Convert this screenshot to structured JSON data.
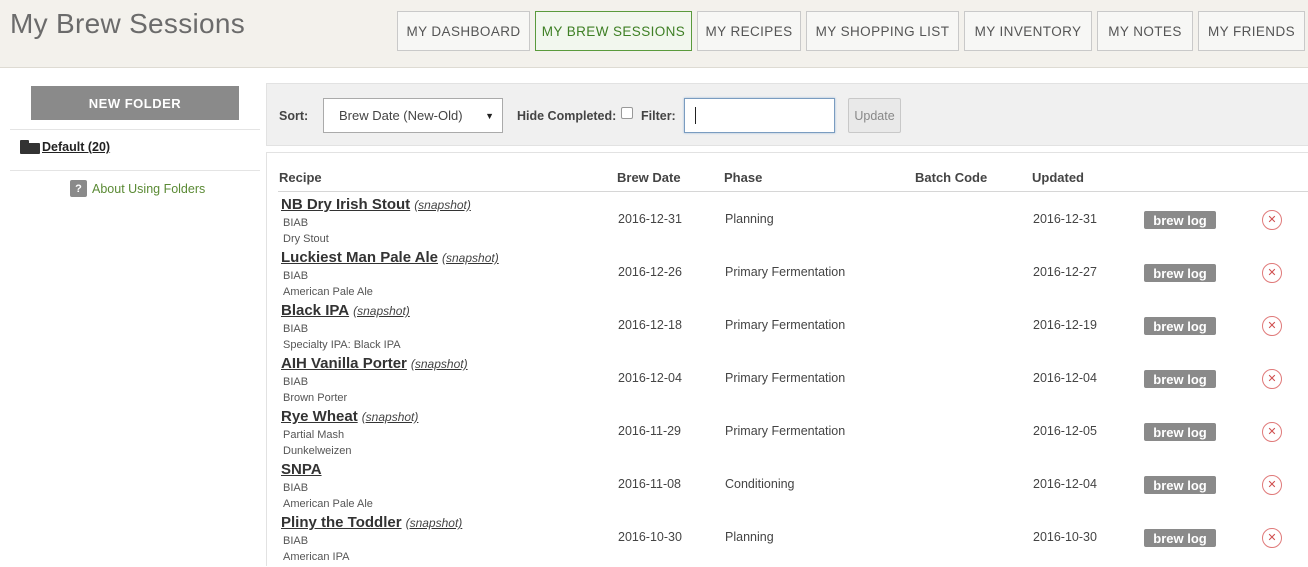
{
  "page": {
    "title": "My Brew Sessions"
  },
  "nav": {
    "tabs": [
      {
        "label": "MY DASHBOARD",
        "active": false
      },
      {
        "label": "MY BREW SESSIONS",
        "active": true
      },
      {
        "label": "MY RECIPES",
        "active": false
      },
      {
        "label": "MY SHOPPING LIST",
        "active": false
      },
      {
        "label": "MY INVENTORY",
        "active": false
      },
      {
        "label": "MY NOTES",
        "active": false
      },
      {
        "label": "MY FRIENDS",
        "active": false
      }
    ]
  },
  "sidebar": {
    "new_folder_label": "NEW FOLDER",
    "folder_label": "Default (20)",
    "help_icon": "?",
    "about_label": "About Using Folders"
  },
  "toolbar": {
    "sort_label": "Sort:",
    "sort_value": "Brew Date (New-Old)",
    "hide_completed_label": "Hide Completed:",
    "filter_label": "Filter:",
    "filter_value": "",
    "update_label": "Update"
  },
  "table": {
    "headers": {
      "recipe": "Recipe",
      "brew_date": "Brew Date",
      "phase": "Phase",
      "batch_code": "Batch Code",
      "updated": "Updated"
    },
    "rows": [
      {
        "name": "NB Dry Irish Stout",
        "snapshot": "(snapshot)",
        "method": "BIAB",
        "style": "Dry Stout",
        "brew_date": "2016-12-31",
        "phase": "Planning",
        "batch_code": "",
        "updated": "2016-12-31",
        "action": "brew log"
      },
      {
        "name": "Luckiest Man Pale Ale",
        "snapshot": "(snapshot)",
        "method": "BIAB",
        "style": "American Pale Ale",
        "brew_date": "2016-12-26",
        "phase": "Primary Fermentation",
        "batch_code": "",
        "updated": "2016-12-27",
        "action": "brew log"
      },
      {
        "name": "Black IPA",
        "snapshot": "(snapshot)",
        "method": "BIAB",
        "style": "Specialty IPA: Black IPA",
        "brew_date": "2016-12-18",
        "phase": "Primary Fermentation",
        "batch_code": "",
        "updated": "2016-12-19",
        "action": "brew log"
      },
      {
        "name": "AIH Vanilla Porter",
        "snapshot": "(snapshot)",
        "method": "BIAB",
        "style": "Brown Porter",
        "brew_date": "2016-12-04",
        "phase": "Primary Fermentation",
        "batch_code": "",
        "updated": "2016-12-04",
        "action": "brew log"
      },
      {
        "name": "Rye Wheat",
        "snapshot": "(snapshot)",
        "method": "Partial Mash",
        "style": "Dunkelweizen",
        "brew_date": "2016-11-29",
        "phase": "Primary Fermentation",
        "batch_code": "",
        "updated": "2016-12-05",
        "action": "brew log"
      },
      {
        "name": "SNPA",
        "snapshot": "",
        "method": "BIAB",
        "style": "American Pale Ale",
        "brew_date": "2016-11-08",
        "phase": "Conditioning",
        "batch_code": "",
        "updated": "2016-12-04",
        "action": "brew log"
      },
      {
        "name": "Pliny the Toddler",
        "snapshot": "(snapshot)",
        "method": "BIAB",
        "style": "American IPA",
        "brew_date": "2016-10-30",
        "phase": "Planning",
        "batch_code": "",
        "updated": "2016-10-30",
        "action": "brew log"
      }
    ]
  }
}
